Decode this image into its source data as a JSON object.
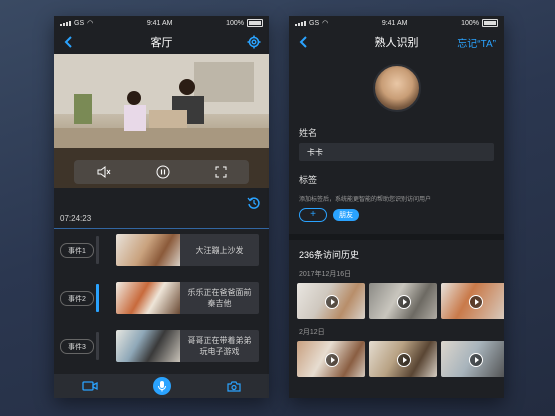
{
  "status": {
    "carrier": "GS",
    "time": "9:41 AM",
    "battery": "100%"
  },
  "colors": {
    "accent": "#2aa3ff",
    "phone_bg": "#1e2024"
  },
  "screen_a": {
    "title": "客厅",
    "icons": {
      "back": "chevron-left-icon",
      "settings": "gear-icon",
      "mute": "speaker-mute-icon",
      "pause": "pause-icon",
      "fullscreen": "fullscreen-icon",
      "history": "history-icon",
      "video": "video-camera-icon",
      "mic": "microphone-icon",
      "snapshot": "camera-icon"
    },
    "timeline_time": "07:24:23",
    "events": [
      {
        "tag": "事件1",
        "desc": "大汪蹦上沙发"
      },
      {
        "tag": "事件2",
        "desc": "乐乐正在爸爸面前秦吉他"
      },
      {
        "tag": "事件3",
        "desc": "哥哥正在带着弟弟玩电子游戏"
      }
    ]
  },
  "screen_b": {
    "title": "熟人识别",
    "forget_label": "忘记“TA”",
    "name_label": "姓名",
    "name_value": "卡卡",
    "tags_label": "标签",
    "tags_hint": "添加标签后，系统能更智能的帮助您识别访问用户",
    "add_tag": "+",
    "tag_chip": "朋友",
    "visit_title": "236条访问历史",
    "groups": [
      {
        "date": "2017年12月16日",
        "count": 3
      },
      {
        "date": "2月12日",
        "count": 3
      }
    ]
  }
}
